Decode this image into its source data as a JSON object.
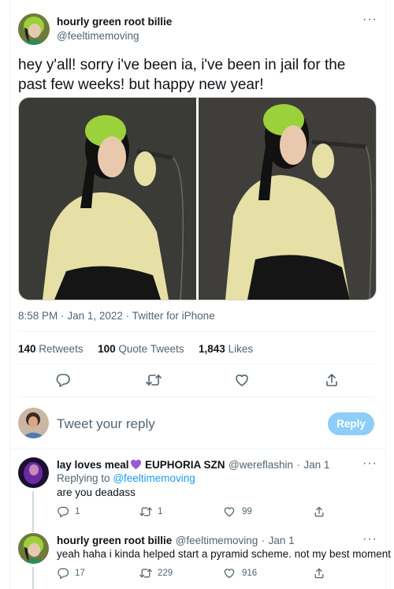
{
  "tweet": {
    "author_name": "hourly green root billie",
    "author_handle": "@feeltimemoving",
    "text": "hey y'all! sorry i've been ia, i've been in jail for the past few weeks! but happy new year!",
    "time": "8:58 PM",
    "date": "Jan 1, 2022",
    "client": "Twitter for iPhone",
    "retweets_count": "140",
    "retweets_label": "Retweets",
    "quotes_count": "100",
    "quotes_label": "Quote Tweets",
    "likes_count": "1,843",
    "likes_label": "Likes"
  },
  "compose": {
    "placeholder": "Tweet your reply",
    "button_label": "Reply"
  },
  "replies": [
    {
      "name": "lay loves meal",
      "name_suffix": "EUPHORIA SZN",
      "handle": "@wereflashin",
      "date": "Jan 1",
      "replying_label": "Replying to",
      "replying_handle": "@feeltimemoving",
      "text": "are you deadass",
      "reply_count": "1",
      "retweet_count": "1",
      "like_count": "99"
    },
    {
      "name": "hourly green root billie",
      "handle": "@feeltimemoving",
      "date": "Jan 1",
      "text": "yeah haha i kinda helped start a pyramid scheme. not my best moment",
      "reply_count": "17",
      "retweet_count": "229",
      "like_count": "916"
    }
  ],
  "icons": {
    "reply": "speech-bubble-icon",
    "retweet": "retweet-icon",
    "like": "heart-icon",
    "share": "share-icon",
    "more": "more-dots-icon",
    "emoji": "purple-heart-emoji"
  },
  "colors": {
    "accent": "#1d9bf0",
    "reply_button": "#8ecdf8",
    "secondary_text": "#536471",
    "emoji_heart": "#9b59d0"
  }
}
